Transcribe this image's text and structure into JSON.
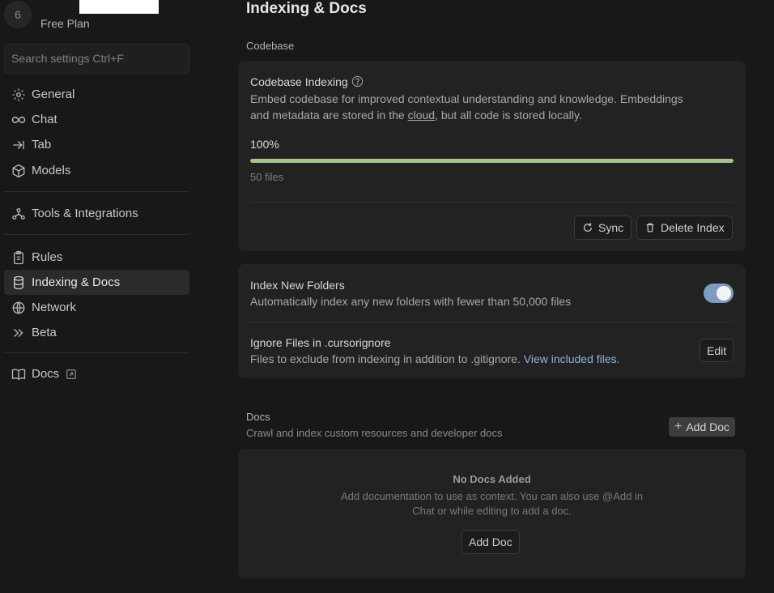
{
  "account": {
    "avatar_initial": "6",
    "plan": "Free Plan"
  },
  "search": {
    "placeholder": "Search settings Ctrl+F"
  },
  "sidebar": {
    "items": [
      {
        "label": "General",
        "icon": "gear-icon"
      },
      {
        "label": "Chat",
        "icon": "infinity-icon"
      },
      {
        "label": "Tab",
        "icon": "arrow-right-to-line-icon"
      },
      {
        "label": "Models",
        "icon": "cube-icon"
      },
      {
        "label": "Tools & Integrations",
        "icon": "nodes-icon"
      },
      {
        "label": "Rules",
        "icon": "clipboard-icon"
      },
      {
        "label": "Indexing & Docs",
        "icon": "database-icon",
        "active": true
      },
      {
        "label": "Network",
        "icon": "globe-icon"
      },
      {
        "label": "Beta",
        "icon": "double-chevron-icon"
      },
      {
        "label": "Docs",
        "icon": "book-icon",
        "external": true
      }
    ]
  },
  "page": {
    "title": "Indexing & Docs"
  },
  "codebase": {
    "section_label": "Codebase",
    "indexing_title": "Codebase Indexing",
    "desc_line1": "Embed codebase for improved contextual understanding and knowledge. Embeddings",
    "desc_line2_a": "and metadata are stored in the ",
    "desc_line2_link": "cloud",
    "desc_line2_b": ", but all code is stored locally.",
    "progress_label": "100%",
    "progress_value": 1.0,
    "files_count": "50 files",
    "sync_label": "Sync",
    "delete_label": "Delete Index"
  },
  "settings": {
    "new_folders_title": "Index New Folders",
    "new_folders_desc": "Automatically index any new folders with fewer than 50,000 files",
    "new_folders_enabled": true,
    "ignore_title": "Ignore Files in .cursorignore",
    "ignore_desc": "Files to exclude from indexing in addition to .gitignore. ",
    "ignore_link": "View included files.",
    "edit_label": "Edit"
  },
  "docs": {
    "section_label": "Docs",
    "section_desc": "Crawl and index custom resources and developer docs",
    "add_doc_top": "Add Doc",
    "empty_title": "No Docs Added",
    "empty_desc_line1": "Add documentation to use as context. You can also use @Add in",
    "empty_desc_line2": "Chat or while editing to add a doc.",
    "add_doc_button": "Add Doc"
  },
  "colors": {
    "background": "#181818",
    "card": "#222222",
    "progress": "#a6c48a",
    "toggle_on": "#7d9cc0",
    "link": "#8fb3d9"
  }
}
